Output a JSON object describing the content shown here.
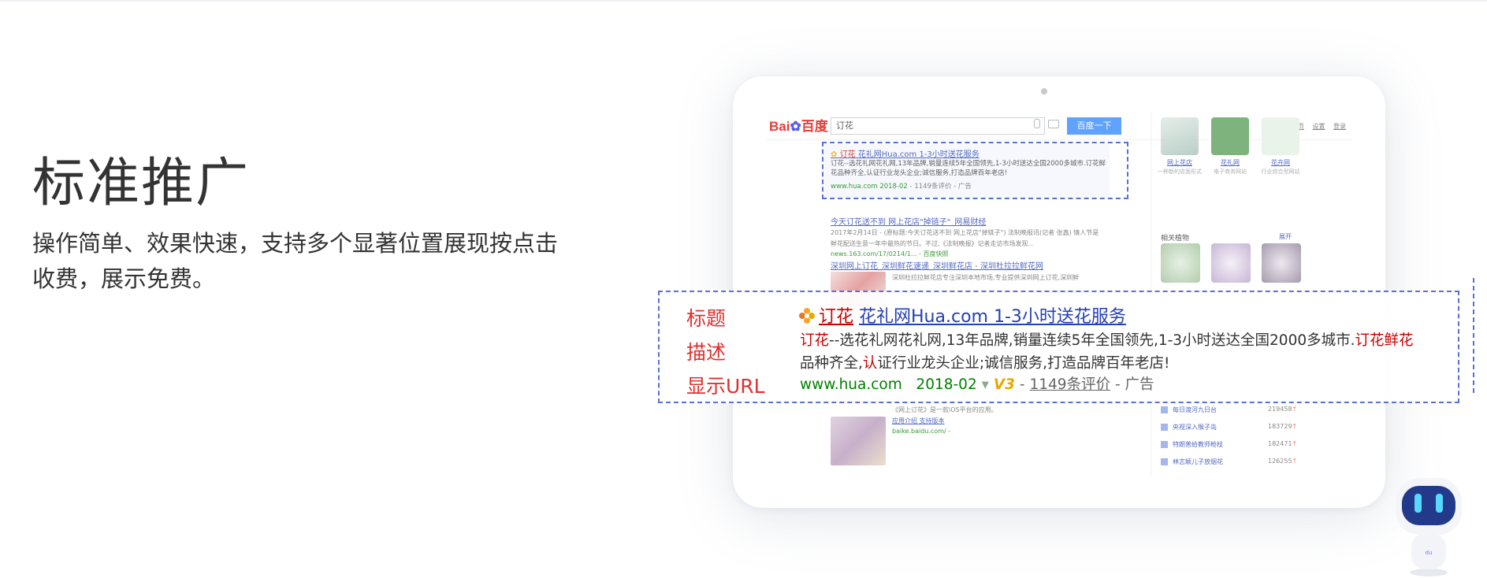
{
  "heading": "标准推广",
  "description": "操作简单、效果快速，支持多个显著位置展现按点击收费，展示免费。",
  "labels": {
    "title": "标题",
    "desc": "描述",
    "url": "显示URL"
  },
  "ad": {
    "title_red": "订花",
    "title_blue": "花礼网Hua.com 1-3小时送花服务",
    "desc_red1": "订花",
    "desc_mid": "--选花礼网花礼网,13年品牌,销量连续5年全国领先,1-3小时送达全国2000多城市.",
    "desc_red2": "订花鲜花",
    "desc_line2a": "品种齐全,",
    "desc_line2red": "认",
    "desc_line2b": "证行业龙头企业;诚信服务,打造品牌百年老店!",
    "url": "www.hua.com",
    "date": "2018-02",
    "v3": "V3",
    "reviews": "1149条评价",
    "tag": "- 广告"
  },
  "browser": {
    "logo": "Bai",
    "logo2": "百度",
    "query": "订花",
    "search_button": "百度一下",
    "links": [
      "百度首页",
      "设置",
      "登录"
    ]
  },
  "mini_ad": {
    "title_red": "订花",
    "title_blue": " 花礼网Hua.com 1-3小时送花服务",
    "desc": "订花--选花礼网花礼网,13年品牌,销量连续5年全国领先,1-3小时送达全国2000多城市.订花鲜花品种齐全,认证行业龙头企业;诚信服务,打造品牌百年老店!",
    "url": "www.hua.com  2018-02",
    "rest": " - 1149条评价 - 广告"
  },
  "results": [
    {
      "title": "今天订花送不到 网上花店\"掉链子\"_网易财经",
      "desc": "2017年2月14日 - (原标题:今天订花送不到 网上花店\"掉链子\") 法制晚报讯(记者 张鑫) 情人节是",
      "desc2": "鲜花配送生意一年中最热的节日。不过,《法制晚报》记者走访市场发现...",
      "url": "news.163.com/17/0214/1... - 百度快照"
    },
    {
      "title": "深圳网上订花_深圳鲜花速递_深圳鲜花店 - 深圳杜拉拉鲜花网",
      "desc": "深圳杜拉拉鲜花店专注深圳本地市场,专业提供深圳网上订花,深圳鲜",
      "desc2": "",
      "url": ""
    },
    {
      "title": "《网上订花》是一款iOS平台的应用。",
      "desc": "应用介绍  支持版本",
      "desc2": "",
      "url": "baike.baidu.com/ -"
    }
  ],
  "right_col": {
    "apps": [
      {
        "name": "网上花店",
        "sub": "一种新的店面形式"
      },
      {
        "name": "花礼网",
        "sub": "电子商务网站"
      },
      {
        "name": "花卉网",
        "sub": "行业综合型网站"
      }
    ],
    "related_title": "相关植物",
    "related_more": "展开",
    "ranks": [
      {
        "name": "每日渡河九日台",
        "num": "219458"
      },
      {
        "name": "央视深入猴子岛",
        "num": "183729"
      },
      {
        "name": "特朗普给教师枪枝",
        "num": "182471"
      },
      {
        "name": "林志颖儿子放烟花",
        "num": "126255"
      }
    ]
  },
  "colors": {
    "label_red": "#e0302f",
    "link_blue": "#2440b3",
    "ad_red": "#cc0000",
    "url_green": "#008000",
    "dash_blue": "#5a6fd8",
    "baidu_blue": "#3388ff"
  },
  "icons": [
    "flower-icon",
    "mic-icon",
    "camera-icon",
    "robot-mascot"
  ]
}
